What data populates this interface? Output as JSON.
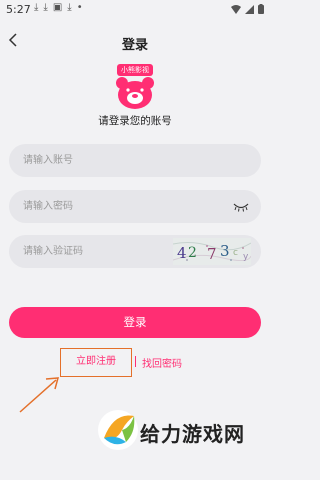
{
  "status_bar": {
    "time": "5:27",
    "notification_icons": [
      "download-icon",
      "download-icon",
      "a-box-icon",
      "download-icon",
      "dot-icon"
    ],
    "right_icons": [
      "wifi-icon",
      "signal-icon",
      "battery-icon"
    ]
  },
  "header": {
    "back_icon": "chevron-left-icon",
    "title": "登录"
  },
  "logo": {
    "tag_text": "小熊影视",
    "brand_color": "#ff2e73"
  },
  "subtitle": "请登录您的账号",
  "form": {
    "username_placeholder": "请输入账号",
    "password_placeholder": "请输入密码",
    "captcha_placeholder": "请输入验证码",
    "password_toggle_icon": "eye-closed-icon",
    "captcha_text": "42 73"
  },
  "login_button": "登录",
  "links": {
    "register": "立即注册",
    "forgot_password": "找回密码"
  },
  "watermark": {
    "text": "给力游戏网"
  },
  "colors": {
    "accent": "#ff2e73",
    "highlight_box": "#e4702a",
    "field_bg": "#e6e6ea",
    "page_bg": "#f2f2f4"
  }
}
